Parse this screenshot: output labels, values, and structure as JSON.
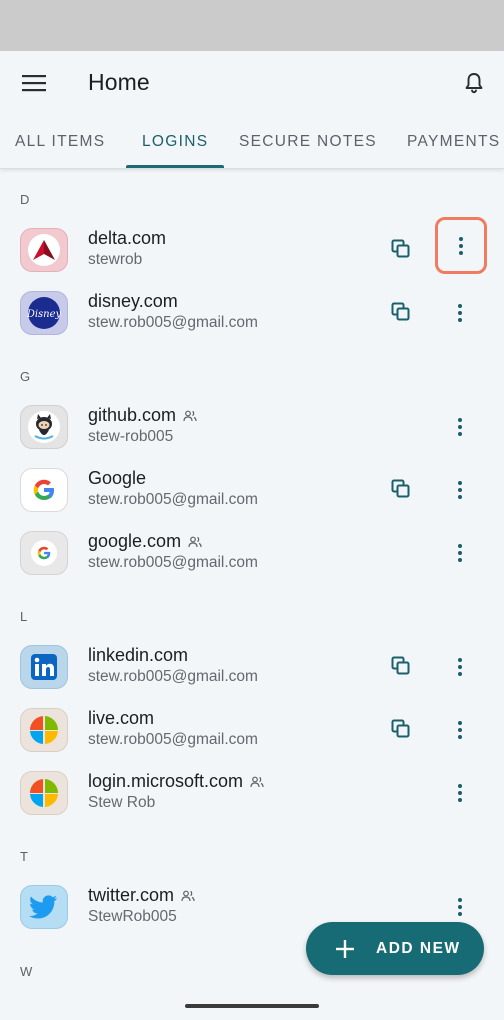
{
  "app_bar": {
    "title": "Home"
  },
  "tabs": [
    {
      "label": "ALL ITEMS"
    },
    {
      "label": "LOGINS"
    },
    {
      "label": "SECURE NOTES"
    },
    {
      "label": "PAYMENTS"
    }
  ],
  "sections": {
    "d": "D",
    "g": "G",
    "l": "L",
    "t": "T",
    "w": "W"
  },
  "items": [
    {
      "title": "delta.com",
      "subtitle": "stewrob",
      "icon": "delta-logo-icon"
    },
    {
      "title": "disney.com",
      "subtitle": "stew.rob005@gmail.com",
      "icon": "disney-logo-icon"
    },
    {
      "title": "github.com",
      "subtitle": "stew-rob005",
      "icon": "github-logo-icon"
    },
    {
      "title": "Google",
      "subtitle": "stew.rob005@gmail.com",
      "icon": "google-logo-icon"
    },
    {
      "title": "google.com",
      "subtitle": "stew.rob005@gmail.com",
      "icon": "google-logo-icon"
    },
    {
      "title": "linkedin.com",
      "subtitle": "stew.rob005@gmail.com",
      "icon": "linkedin-logo-icon"
    },
    {
      "title": "live.com",
      "subtitle": "stew.rob005@gmail.com",
      "icon": "microsoft-logo-icon"
    },
    {
      "title": "login.microsoft.com",
      "subtitle": "Stew Rob",
      "icon": "microsoft-logo-icon"
    },
    {
      "title": "twitter.com",
      "subtitle": "StewRob005",
      "icon": "twitter-logo-icon"
    }
  ],
  "fab": {
    "label": "ADD NEW"
  },
  "colors": {
    "accent": "#176b75",
    "highlight": "#f07b61"
  }
}
